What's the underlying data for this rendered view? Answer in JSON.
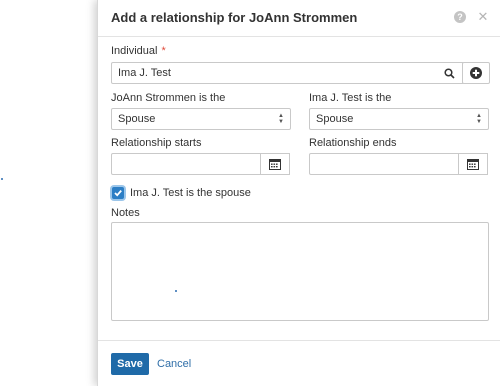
{
  "dialog": {
    "title": "Add a relationship for JoAnn Strommen",
    "help_icon": "question-circle-icon",
    "close_icon": "close-icon"
  },
  "individual": {
    "label": "Individual",
    "required_marker": "*",
    "value": "Ima J. Test",
    "search_icon": "search-icon",
    "add_icon": "plus-circle-icon"
  },
  "relation_left": {
    "label": "JoAnn Strommen is the",
    "selected": "Spouse"
  },
  "relation_right": {
    "label": "Ima J. Test is the",
    "selected": "Spouse"
  },
  "starts": {
    "label": "Relationship starts",
    "value": "",
    "icon": "calendar-icon"
  },
  "ends": {
    "label": "Relationship ends",
    "value": "",
    "icon": "calendar-icon"
  },
  "spouse_checkbox": {
    "label": "Ima J. Test is the spouse",
    "checked": true
  },
  "notes": {
    "label": "Notes",
    "value": ""
  },
  "footer": {
    "save_label": "Save",
    "cancel_label": "Cancel"
  },
  "colors": {
    "primary": "#1f6aa8",
    "required": "#e04a3a",
    "link": "#2f6ea8"
  }
}
